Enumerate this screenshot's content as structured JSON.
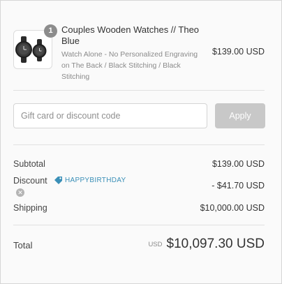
{
  "product": {
    "quantity": "1",
    "title": "Couples Wooden Watches // Theo Blue",
    "variant": "Watch Alone - No Personalized Engraving on The Back / Black Stitching / Black Stitching",
    "price": "$139.00 USD",
    "image_icon": "watch-pair-icon"
  },
  "discount_form": {
    "placeholder": "Gift card or discount code",
    "value": "",
    "apply_label": "Apply"
  },
  "summary": {
    "subtotal_label": "Subtotal",
    "subtotal_value": "$139.00 USD",
    "discount_label": "Discount",
    "discount_code": "HAPPYBIRTHDAY",
    "discount_value": "- $41.70 USD",
    "shipping_label": "Shipping",
    "shipping_value": "$10,000.00 USD"
  },
  "total": {
    "label": "Total",
    "currency": "USD",
    "amount": "$10,097.30 USD"
  },
  "colors": {
    "accent": "#3a8fb7",
    "apply_disabled": "#c8c8c8",
    "badge": "#8c8c8c"
  }
}
